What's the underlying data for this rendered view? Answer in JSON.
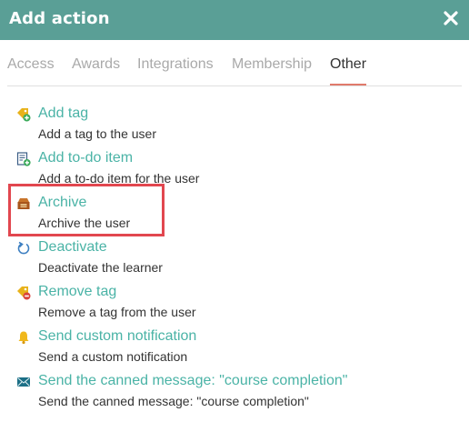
{
  "dialog": {
    "title": "Add action",
    "close_icon": "close-x-icon"
  },
  "tabs": [
    {
      "label": "Access",
      "active": false
    },
    {
      "label": "Awards",
      "active": false
    },
    {
      "label": "Integrations",
      "active": false
    },
    {
      "label": "Membership",
      "active": false
    },
    {
      "label": "Other",
      "active": true
    }
  ],
  "actions": [
    {
      "label": "Add tag",
      "description": "Add a tag to the user",
      "icon": "tag-add-icon"
    },
    {
      "label": "Add to-do item",
      "description": "Add a to-do item for the user",
      "icon": "todo-add-icon"
    },
    {
      "label": "Archive",
      "description": "Archive the user",
      "icon": "archive-box-icon",
      "highlighted": true
    },
    {
      "label": "Deactivate",
      "description": "Deactivate the learner",
      "icon": "undo-arrow-icon"
    },
    {
      "label": "Remove tag",
      "description": "Remove a tag from the user",
      "icon": "tag-remove-icon"
    },
    {
      "label": "Send custom notification",
      "description": "Send a custom notification",
      "icon": "bell-icon"
    },
    {
      "label": "Send the canned message: \"course completion\"",
      "description": "Send the canned message: \"course completion\"",
      "icon": "envelope-icon"
    }
  ],
  "colors": {
    "header": "#5a9f96",
    "link": "#4ab3a6",
    "tab_active_underline": "#e07a6b",
    "highlight_border": "#e2474f",
    "tab_inactive": "#a9a9a9"
  }
}
